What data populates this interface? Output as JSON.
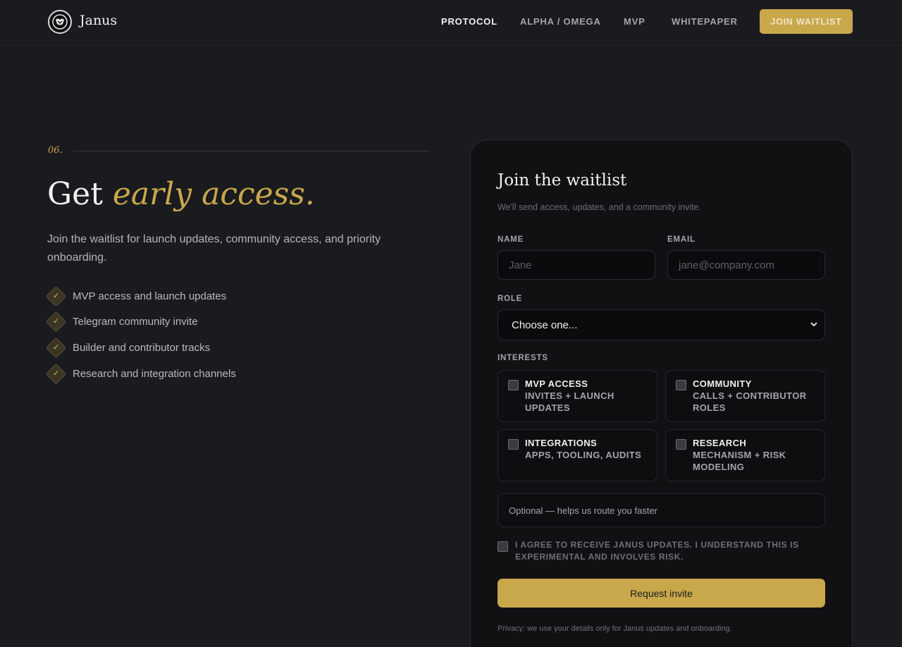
{
  "header": {
    "brand": "Janus",
    "logo_icon": "janus-emblem-icon",
    "nav": [
      {
        "label": "PROTOCOL",
        "active": true
      },
      {
        "label": "ALPHA / OMEGA",
        "active": false
      },
      {
        "label": "MVP",
        "active": false
      },
      {
        "label": "WHITEPAPER",
        "active": false
      }
    ],
    "cta": "JOIN WAITLIST"
  },
  "hero": {
    "section_number": "06.",
    "title_plain": "Get ",
    "title_accent": "early access.",
    "description": "Join the waitlist for launch updates, community access, and priority onboarding.",
    "benefits": [
      "MVP access and launch updates",
      "Telegram community invite",
      "Builder and contributor tracks",
      "Research and integration channels"
    ],
    "benefit_icon": "check-icon"
  },
  "form": {
    "title": "Join the waitlist",
    "subtitle": "We'll send access, updates, and a community invite.",
    "name_label": "NAME",
    "name_placeholder": "Jane",
    "email_label": "EMAIL",
    "email_placeholder": "jane@company.com",
    "role_label": "ROLE",
    "role_value": "Choose one...",
    "interests_label": "INTERESTS",
    "interests": [
      {
        "title": "MVP ACCESS",
        "desc": "INVITES + LAUNCH UPDATES",
        "checked": false
      },
      {
        "title": "COMMUNITY",
        "desc": "CALLS + CONTRIBUTOR ROLES",
        "checked": false
      },
      {
        "title": "INTEGRATIONS",
        "desc": "APPS, TOOLING, AUDITS",
        "checked": false
      },
      {
        "title": "RESEARCH",
        "desc": "MECHANISM + RISK MODELING",
        "checked": false
      }
    ],
    "optional_placeholder": "Optional — helps us route you faster",
    "agree_text": "I AGREE TO RECEIVE JANUS UPDATES. I UNDERSTAND THIS IS EXPERIMENTAL AND INVOLVES RISK.",
    "agree_checked": false,
    "submit": "Request invite",
    "privacy": "Privacy: we use your details only for Janus updates and onboarding."
  },
  "colors": {
    "background": "#1a1b1f",
    "card": "#111114",
    "accent_gold": "#c9a74b",
    "text_primary": "#f0f0f0",
    "text_muted": "#a4a5ab"
  }
}
